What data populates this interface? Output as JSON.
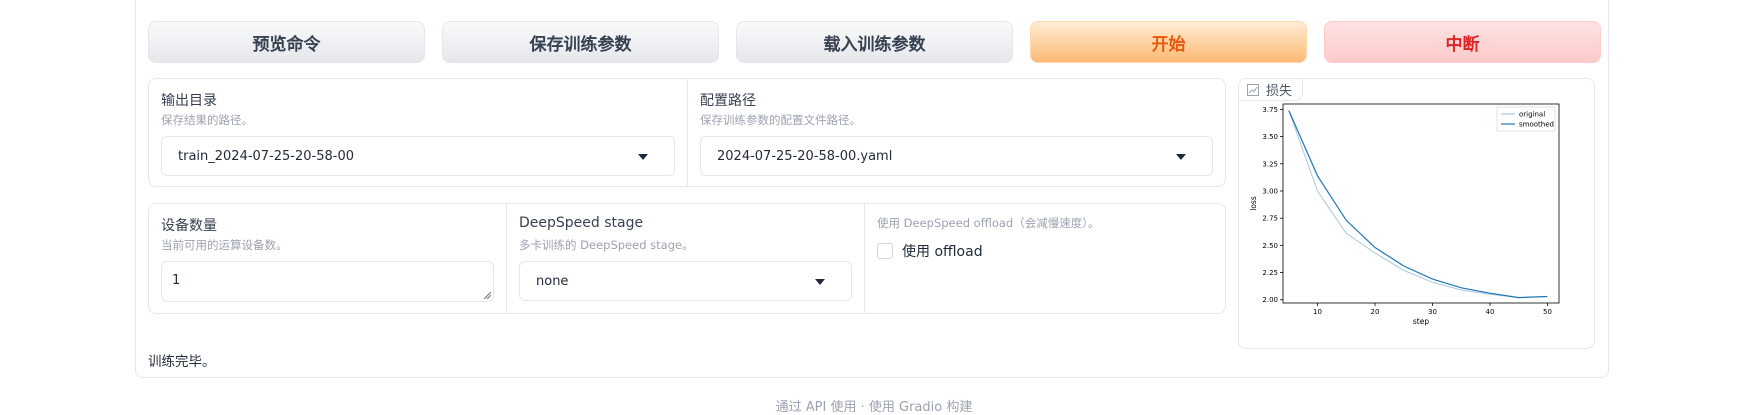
{
  "buttons": {
    "preview": "预览命令",
    "save_args": "保存训练参数",
    "load_args": "载入训练参数",
    "start": "开始",
    "abort": "中断"
  },
  "output_dir": {
    "label": "输出目录",
    "info": "保存结果的路径。",
    "value": "train_2024-07-25-20-58-00"
  },
  "config_path": {
    "label": "配置路径",
    "info": "保存训练参数的配置文件路径。",
    "value": "2024-07-25-20-58-00.yaml"
  },
  "device_count": {
    "label": "设备数量",
    "info": "当前可用的运算设备数。",
    "value": "1"
  },
  "ds_stage": {
    "label": "DeepSpeed stage",
    "info": "多卡训练的 DeepSpeed stage。",
    "value": "none"
  },
  "ds_offload": {
    "info": "使用 DeepSpeed offload（会减慢速度）。",
    "checkbox_label": "使用 offload",
    "checked": false
  },
  "loss_plot": {
    "label": "损失",
    "icon": "chart-icon"
  },
  "chart_data": {
    "type": "line",
    "title": "",
    "xlabel": "step",
    "ylabel": "loss",
    "xlim": [
      4,
      52
    ],
    "ylim": [
      1.97,
      3.8
    ],
    "xticks": [
      10,
      20,
      30,
      40,
      50
    ],
    "yticks": [
      2.0,
      2.25,
      2.5,
      2.75,
      3.0,
      3.25,
      3.5,
      3.75
    ],
    "legend_position": "top-right",
    "grid": false,
    "x": [
      5,
      10,
      15,
      20,
      25,
      30,
      35,
      40,
      45,
      50
    ],
    "series": [
      {
        "name": "original",
        "color": "#a8c8dd",
        "values": [
          3.74,
          3.0,
          2.61,
          2.43,
          2.27,
          2.16,
          2.09,
          2.05,
          2.02,
          2.03
        ]
      },
      {
        "name": "smoothed",
        "color": "#1f77b4",
        "values": [
          3.74,
          3.14,
          2.73,
          2.48,
          2.31,
          2.19,
          2.11,
          2.06,
          2.02,
          2.03
        ]
      }
    ]
  },
  "status_text": "训练完毕。",
  "footer": "通过 API 使用 · 使用 Gradio 构建"
}
